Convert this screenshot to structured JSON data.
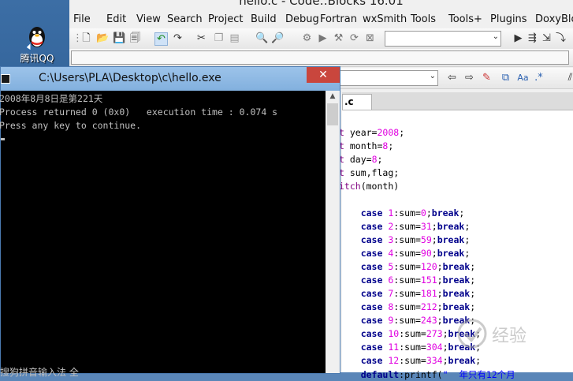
{
  "desktop": {
    "qq_label": "腾讯QQ"
  },
  "codeblocks": {
    "title": "hello.c - Code::Blocks 16.01",
    "menu": [
      "File",
      "Edit",
      "View",
      "Search",
      "Project",
      "Build",
      "Debug",
      "Fortran",
      "wxSmith",
      "Tools",
      "Tools+",
      "Plugins",
      "DoxyBlo"
    ],
    "tab_label": ".c",
    "code_lines": [
      {
        "pre": "t ",
        "parts": [
          [
            "id",
            "year="
          ],
          [
            "num",
            "2008"
          ],
          [
            "op",
            ";"
          ]
        ]
      },
      {
        "pre": "t ",
        "parts": [
          [
            "id",
            "month="
          ],
          [
            "num",
            "8"
          ],
          [
            "op",
            ";"
          ]
        ]
      },
      {
        "pre": "t ",
        "parts": [
          [
            "id",
            "day="
          ],
          [
            "num",
            "8"
          ],
          [
            "op",
            ";"
          ]
        ]
      },
      {
        "pre": "t ",
        "parts": [
          [
            "id",
            "sum,flag;"
          ]
        ]
      },
      {
        "pre": "",
        "parts": [
          [
            "kw2",
            "itch"
          ],
          [
            "id",
            "(month)"
          ]
        ]
      },
      {
        "pre": "",
        "parts": []
      },
      {
        "pre": "    ",
        "parts": [
          [
            "kw",
            "case "
          ],
          [
            "num",
            "1"
          ],
          [
            "id",
            ":sum="
          ],
          [
            "num",
            "0"
          ],
          [
            "id",
            ";"
          ],
          [
            "kw",
            "break"
          ],
          [
            "id",
            ";"
          ]
        ]
      },
      {
        "pre": "    ",
        "parts": [
          [
            "kw",
            "case "
          ],
          [
            "num",
            "2"
          ],
          [
            "id",
            ":sum="
          ],
          [
            "num",
            "31"
          ],
          [
            "id",
            ";"
          ],
          [
            "kw",
            "break"
          ],
          [
            "id",
            ";"
          ]
        ]
      },
      {
        "pre": "    ",
        "parts": [
          [
            "kw",
            "case "
          ],
          [
            "num",
            "3"
          ],
          [
            "id",
            ":sum="
          ],
          [
            "num",
            "59"
          ],
          [
            "id",
            ";"
          ],
          [
            "kw",
            "break"
          ],
          [
            "id",
            ";"
          ]
        ]
      },
      {
        "pre": "    ",
        "parts": [
          [
            "kw",
            "case "
          ],
          [
            "num",
            "4"
          ],
          [
            "id",
            ":sum="
          ],
          [
            "num",
            "90"
          ],
          [
            "id",
            ";"
          ],
          [
            "kw",
            "break"
          ],
          [
            "id",
            ";"
          ]
        ]
      },
      {
        "pre": "    ",
        "parts": [
          [
            "kw",
            "case "
          ],
          [
            "num",
            "5"
          ],
          [
            "id",
            ":sum="
          ],
          [
            "num",
            "120"
          ],
          [
            "id",
            ";"
          ],
          [
            "kw",
            "break"
          ],
          [
            "id",
            ";"
          ]
        ]
      },
      {
        "pre": "    ",
        "parts": [
          [
            "kw",
            "case "
          ],
          [
            "num",
            "6"
          ],
          [
            "id",
            ":sum="
          ],
          [
            "num",
            "151"
          ],
          [
            "id",
            ";"
          ],
          [
            "kw",
            "break"
          ],
          [
            "id",
            ";"
          ]
        ]
      },
      {
        "pre": "    ",
        "parts": [
          [
            "kw",
            "case "
          ],
          [
            "num",
            "7"
          ],
          [
            "id",
            ":sum="
          ],
          [
            "num",
            "181"
          ],
          [
            "id",
            ";"
          ],
          [
            "kw",
            "break"
          ],
          [
            "id",
            ";"
          ]
        ]
      },
      {
        "pre": "    ",
        "parts": [
          [
            "kw",
            "case "
          ],
          [
            "num",
            "8"
          ],
          [
            "id",
            ":sum="
          ],
          [
            "num",
            "212"
          ],
          [
            "id",
            ";"
          ],
          [
            "kw",
            "break"
          ],
          [
            "id",
            ";"
          ]
        ]
      },
      {
        "pre": "    ",
        "parts": [
          [
            "kw",
            "case "
          ],
          [
            "num",
            "9"
          ],
          [
            "id",
            ":sum="
          ],
          [
            "num",
            "243"
          ],
          [
            "id",
            ";"
          ],
          [
            "kw",
            "break"
          ],
          [
            "id",
            ";"
          ]
        ]
      },
      {
        "pre": "    ",
        "parts": [
          [
            "kw",
            "case "
          ],
          [
            "num",
            "10"
          ],
          [
            "id",
            ":sum="
          ],
          [
            "num",
            "273"
          ],
          [
            "id",
            ";"
          ],
          [
            "kw",
            "break"
          ],
          [
            "id",
            ";"
          ]
        ]
      },
      {
        "pre": "    ",
        "parts": [
          [
            "kw",
            "case "
          ],
          [
            "num",
            "11"
          ],
          [
            "id",
            ":sum="
          ],
          [
            "num",
            "304"
          ],
          [
            "id",
            ";"
          ],
          [
            "kw",
            "break"
          ],
          [
            "id",
            ";"
          ]
        ]
      },
      {
        "pre": "    ",
        "parts": [
          [
            "kw",
            "case "
          ],
          [
            "num",
            "12"
          ],
          [
            "id",
            ":sum="
          ],
          [
            "num",
            "334"
          ],
          [
            "id",
            ";"
          ],
          [
            "kw",
            "break"
          ],
          [
            "id",
            ";"
          ]
        ]
      },
      {
        "pre": "    ",
        "parts": [
          [
            "kw",
            "default"
          ],
          [
            "id",
            ":printf("
          ],
          [
            "str",
            "\"  年只有12个月"
          ]
        ]
      }
    ]
  },
  "console": {
    "title": "C:\\Users\\PLA\\Desktop\\c\\hello.exe",
    "close_glyph": "✕",
    "lines": [
      "2008年8月8日是第221天",
      "Process returned 0 (0x0)   execution time : 0.074 s",
      "Press any key to continue."
    ],
    "ime_text": "搜狗拼音输入法 全"
  },
  "watermark": "经验"
}
